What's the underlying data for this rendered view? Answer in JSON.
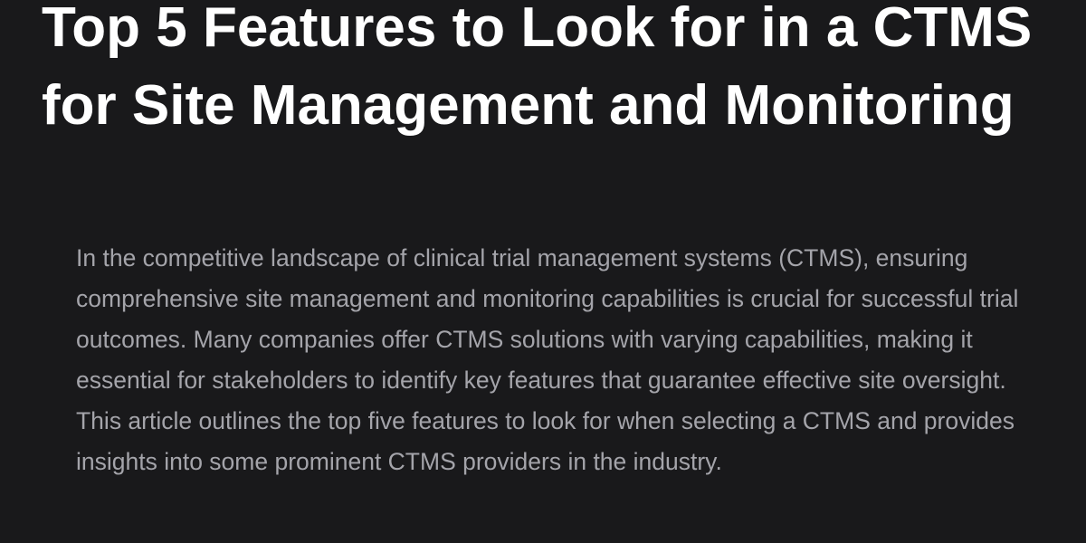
{
  "article": {
    "title": "Top 5 Features to Look for in a CTMS for Site Management and Monitoring",
    "intro": "In the competitive landscape of clinical trial management systems (CTMS), ensuring comprehensive site management and monitoring capabilities is crucial for successful trial outcomes. Many companies offer CTMS solutions with varying capabilities, making it essential for stakeholders to identify key features that guarantee effective site oversight. This article outlines the top five features to look for when selecting a CTMS and provides insights into some prominent CTMS providers in the industry."
  },
  "colors": {
    "background": "#19191b",
    "title": "#ffffff",
    "body_text": "#a4a4aa"
  }
}
